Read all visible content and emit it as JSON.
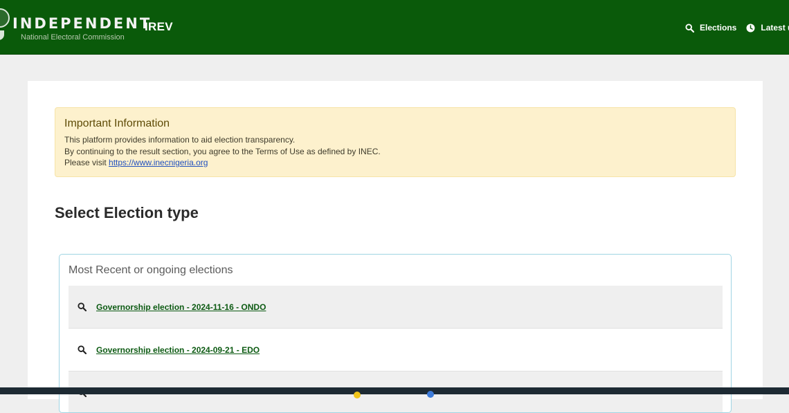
{
  "header": {
    "brand_title": "INDEPENDENT",
    "brand_subtitle": "National Electoral Commission",
    "app_name": "IREV",
    "nav": [
      {
        "icon": "search-icon",
        "label": "Elections"
      },
      {
        "icon": "clock-icon",
        "label": "Latest upl"
      }
    ]
  },
  "alert": {
    "title": "Important Information",
    "lines": [
      "This platform provides information to aid election transparency.",
      "By continuing to the result section, you agree to the Terms of Use as defined by INEC."
    ],
    "visit_prefix": "Please visit ",
    "visit_link": "https://www.inecnigeria.org"
  },
  "section_title": "Select Election type",
  "elections_panel": {
    "title": "Most Recent or ongoing elections",
    "items": [
      {
        "icon": "search-icon",
        "label": "Governorship election - 2024-11-16 - ONDO"
      },
      {
        "icon": "search-icon",
        "label": "Governorship election - 2024-09-21 - EDO"
      },
      {
        "icon": "search-icon",
        "label": ""
      }
    ]
  },
  "colors": {
    "header_green": "#0a5a0a",
    "link_green": "#0c5a12",
    "alert_bg": "#fdf1cd",
    "panel_border": "#9fd4e3"
  }
}
